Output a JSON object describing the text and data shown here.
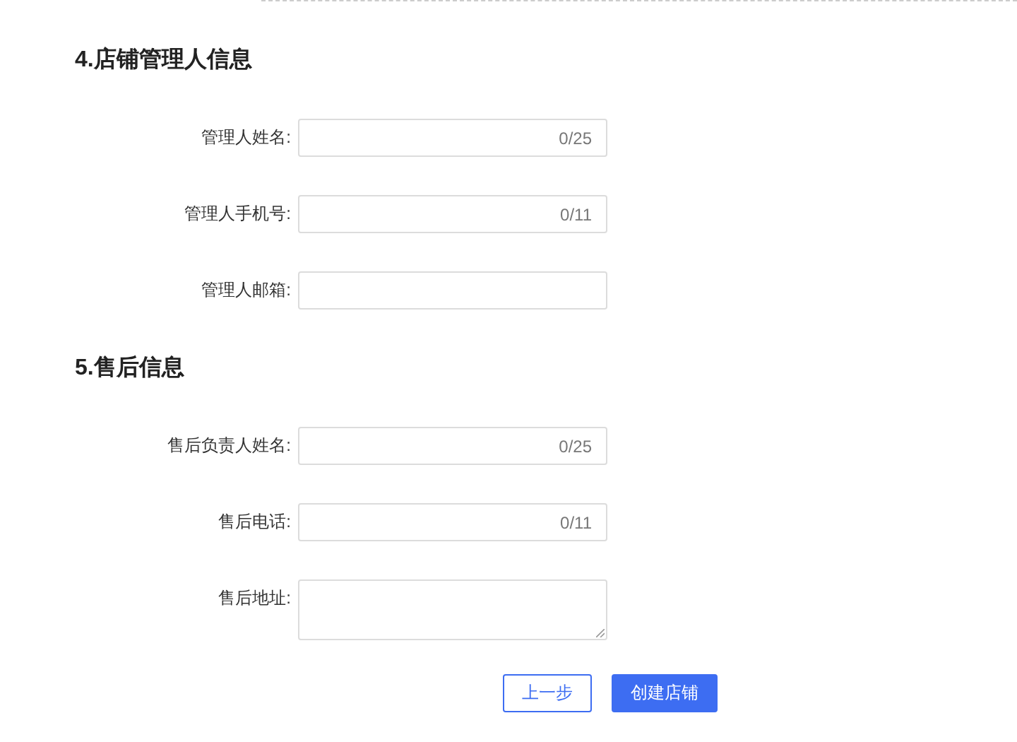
{
  "sections": [
    {
      "title": "4.店铺管理人信息",
      "fields": [
        {
          "kind": "text",
          "label": "管理人姓名:",
          "counter": "0/25"
        },
        {
          "kind": "text",
          "label": "管理人手机号:",
          "counter": "0/11"
        },
        {
          "kind": "text",
          "label": "管理人邮箱:"
        }
      ]
    },
    {
      "title": "5.售后信息",
      "fields": [
        {
          "kind": "text",
          "label": "售后负责人姓名:",
          "counter": "0/25"
        },
        {
          "kind": "text",
          "label": "售后电话:",
          "counter": "0/11"
        },
        {
          "kind": "textarea",
          "label": "售后地址:"
        }
      ]
    }
  ],
  "buttons": [
    {
      "label": "上一步",
      "kind": "secondary"
    },
    {
      "label": "创建店铺",
      "kind": "primary"
    }
  ]
}
